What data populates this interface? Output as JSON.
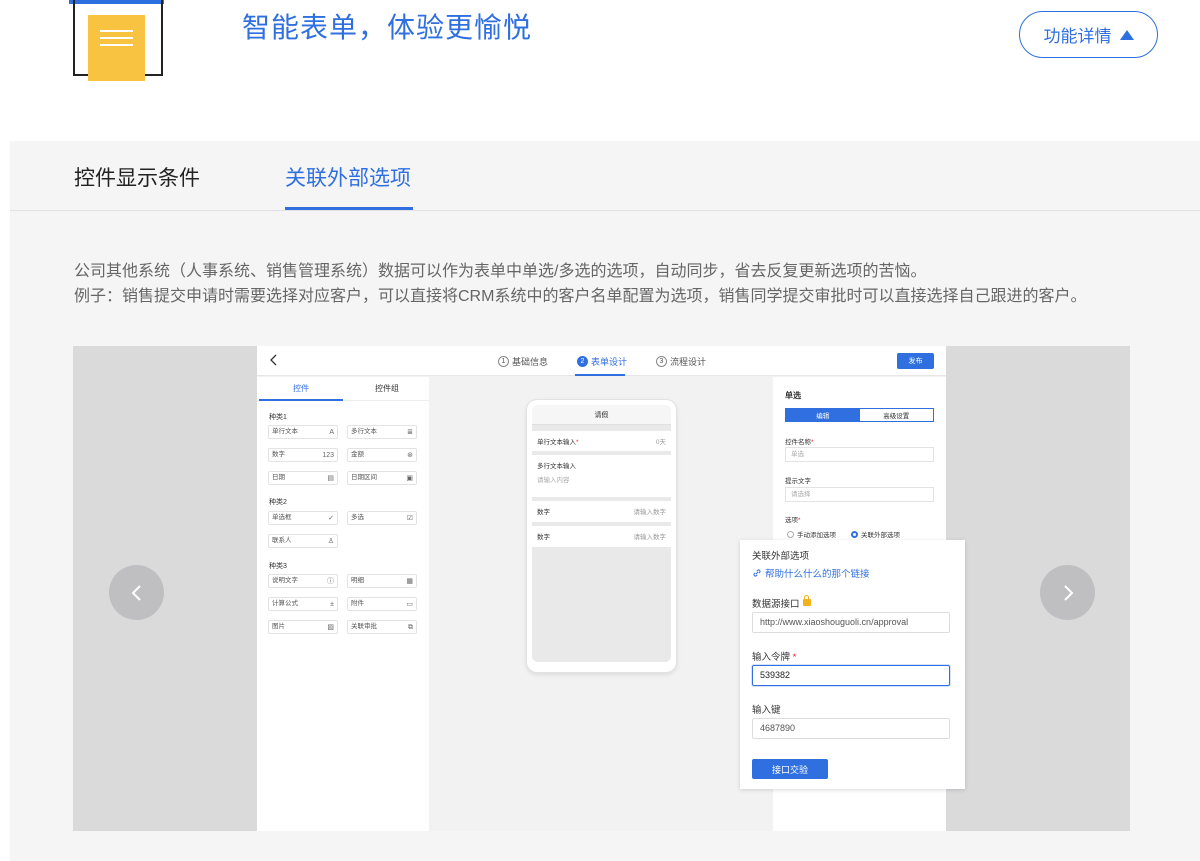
{
  "header": {
    "title": "智能表单，体验更愉悦",
    "detail_button": "功能详情"
  },
  "tabs": [
    {
      "label": "控件显示条件",
      "active": false
    },
    {
      "label": "关联外部选项",
      "active": true
    }
  ],
  "description": {
    "line1": "公司其他系统（人事系统、销售管理系统）数据可以作为表单中单选/多选的选项，自动同步，省去反复更新选项的苦恼。",
    "line2": "例子：销售提交申请时需要选择对应客户，可以直接将CRM系统中的客户名单配置为选项，销售同学提交审批时可以直接选择自己跟进的客户。"
  },
  "app": {
    "steps": [
      {
        "num": "1",
        "label": "基础信息"
      },
      {
        "num": "2",
        "label": "表单设计"
      },
      {
        "num": "3",
        "label": "流程设计"
      }
    ],
    "publish": "发布",
    "left_tabs": [
      "控件",
      "控件组"
    ],
    "categories": [
      {
        "name": "种类1",
        "items": [
          {
            "label": "单行文本",
            "icon": "A"
          },
          {
            "label": "多行文本",
            "icon": "≣"
          },
          {
            "label": "数字",
            "icon": "123"
          },
          {
            "label": "金额",
            "icon": "⊛"
          },
          {
            "label": "日期",
            "icon": "▤"
          },
          {
            "label": "日期区间",
            "icon": "▣"
          }
        ]
      },
      {
        "name": "种类2",
        "items": [
          {
            "label": "单选框",
            "icon": "✓"
          },
          {
            "label": "多选",
            "icon": "☑"
          },
          {
            "label": "联系人",
            "icon": "♙"
          }
        ]
      },
      {
        "name": "种类3",
        "items": [
          {
            "label": "说明文字",
            "icon": "ⓘ"
          },
          {
            "label": "明细",
            "icon": "▦"
          },
          {
            "label": "计算公式",
            "icon": "±"
          },
          {
            "label": "附件",
            "icon": "▭"
          },
          {
            "label": "图片",
            "icon": "▨"
          },
          {
            "label": "关联审批",
            "icon": "⧉"
          }
        ]
      }
    ],
    "phone": {
      "title": "请假",
      "rows": [
        {
          "label": "单行文本输入",
          "required": "*",
          "right": "0天"
        },
        {
          "label": "多行文本输入",
          "sub": "请输入内容"
        },
        {
          "label": "数字",
          "right": "请输入数字"
        },
        {
          "label": "数字",
          "right": "请输入数字"
        }
      ]
    },
    "right_panel": {
      "title": "单选",
      "seg_edit": "编辑",
      "seg_advanced": "高级设置",
      "name_label": "控件名称",
      "name_value": "单选",
      "hint_label": "提示文字",
      "hint_value": "请选择",
      "options_label": "选项",
      "radio_manual": "手动添加选项",
      "radio_external": "关联外部选项"
    },
    "popup": {
      "title": "关联外部选项",
      "help_link": "帮助什么什么的那个链接",
      "source_label": "数据源接口",
      "source_value": "http://www.xiaoshouguoli.cn/approval",
      "token_label": "输入令牌",
      "token_required": "*",
      "token_value": "539382",
      "key_label": "输入键",
      "key_value": "4687890",
      "submit": "接口交验"
    }
  },
  "colors": {
    "accent": "#2f6fe0",
    "logo_doc": "#f7c340"
  }
}
